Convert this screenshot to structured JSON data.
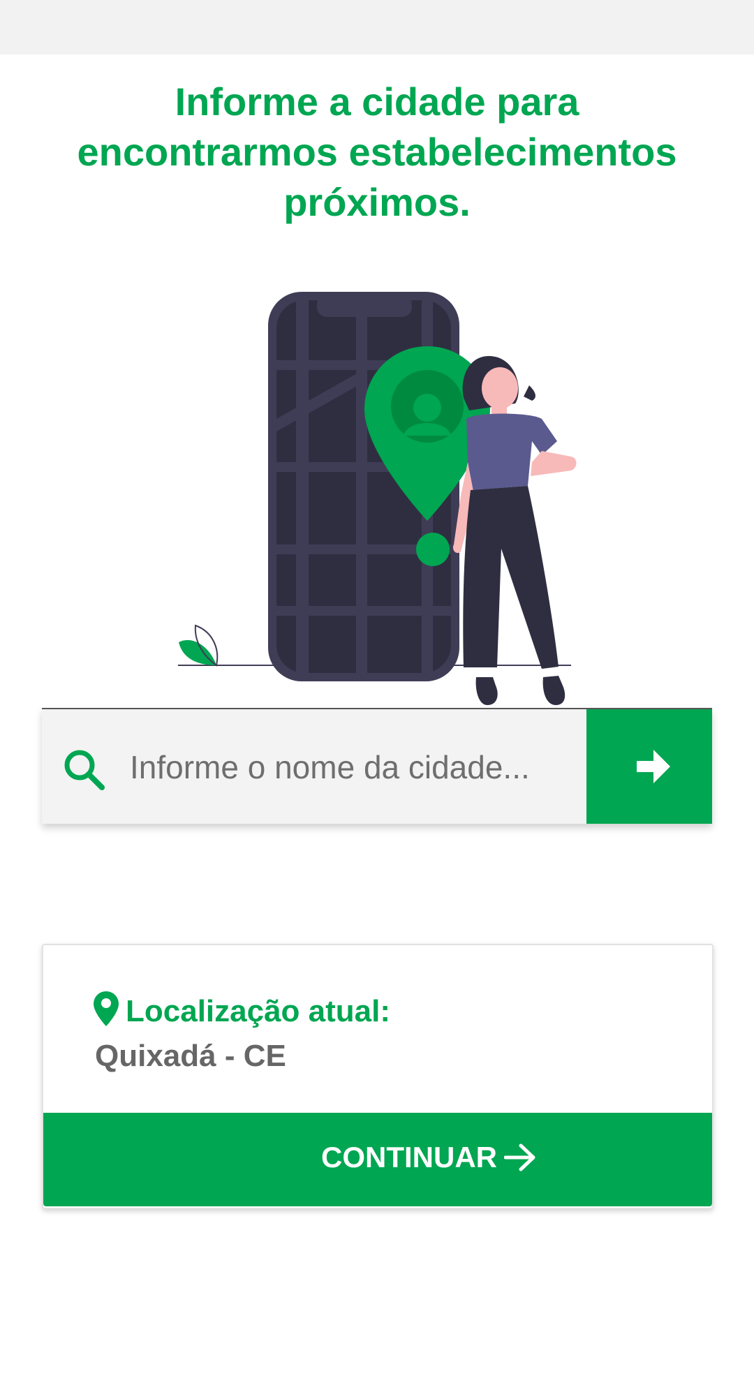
{
  "header": {
    "title_line1": "Informe a cidade para",
    "title_line2": "encontrarmos estabelecimentos",
    "title_line3": "próximos."
  },
  "search": {
    "placeholder": "Informe o nome da cidade...",
    "value": ""
  },
  "location": {
    "label": "Localização atual:",
    "value": "Quixadá - CE",
    "continue_label": "CONTINUAR"
  },
  "icons": {
    "search": "search-icon",
    "go": "arrow-right-icon",
    "pin": "map-pin-icon",
    "continue": "arrow-right-icon"
  },
  "colors": {
    "accent": "#00a651",
    "status_bar": "#f2f2f2",
    "text_muted": "#666666",
    "phone_dark": "#3f3d56"
  }
}
